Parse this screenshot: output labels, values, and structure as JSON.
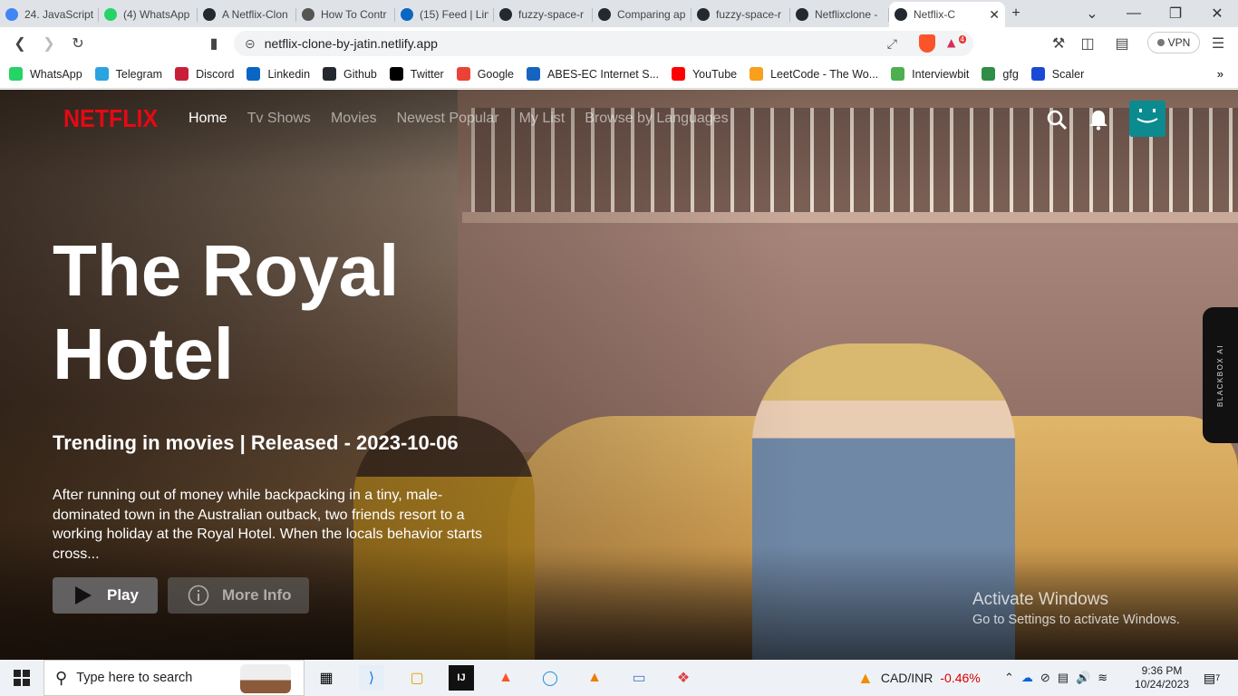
{
  "tabs": [
    {
      "label": "24. JavaScript",
      "color": "#4285f4"
    },
    {
      "label": "(4) WhatsApp",
      "color": "#25d366"
    },
    {
      "label": "A Netflix-Clon",
      "color": "#24292f"
    },
    {
      "label": "How To Contr",
      "color": "#555555"
    },
    {
      "label": "(15) Feed | Lin",
      "color": "#0a66c2"
    },
    {
      "label": "fuzzy-space-r",
      "color": "#24292f"
    },
    {
      "label": "Comparing ap",
      "color": "#24292f"
    },
    {
      "label": "fuzzy-space-r",
      "color": "#24292f"
    },
    {
      "label": "Netflixclone -",
      "color": "#24292f"
    },
    {
      "label": "Netflix-C",
      "color": "#24292f"
    }
  ],
  "address": {
    "url": "netflix-clone-by-jatin.netlify.app",
    "brave_badge": "4",
    "vpn": "VPN"
  },
  "bookmarks": [
    {
      "label": "WhatsApp",
      "color": "#25d366"
    },
    {
      "label": "Telegram",
      "color": "#2aa3df"
    },
    {
      "label": "Discord",
      "color": "#c71f3a"
    },
    {
      "label": "Linkedin",
      "color": "#0a66c2"
    },
    {
      "label": "Github",
      "color": "#24292f"
    },
    {
      "label": "Twitter",
      "color": "#000000"
    },
    {
      "label": "Google",
      "color": "#ea4335"
    },
    {
      "label": "ABES-EC Internet S...",
      "color": "#1565c0"
    },
    {
      "label": "YouTube",
      "color": "#ff0000"
    },
    {
      "label": "LeetCode - The Wo...",
      "color": "#f89f1b"
    },
    {
      "label": "Interviewbit",
      "color": "#4caf50"
    },
    {
      "label": "gfg",
      "color": "#2f8d46"
    },
    {
      "label": "Scaler",
      "color": "#1a49d6"
    }
  ],
  "netflix": {
    "logo": "NETFLIX",
    "nav": [
      "Home",
      "Tv Shows",
      "Movies",
      "Newest Popular",
      "My List",
      "Browse by Languages"
    ],
    "title": "The Royal Hotel",
    "trending": "Trending in movies | Released - 2023-10-06",
    "description": "After running out of money while backpacking in a tiny, male-dominated town in the Australian outback, two friends resort to a working holiday at the Royal Hotel. When the locals behavior starts cross...",
    "play_label": "Play",
    "more_label": "More Info"
  },
  "overlay": {
    "blackbox": "BLACKBOX AI",
    "activate_title": "Activate Windows",
    "activate_sub": "Go to Settings to activate Windows."
  },
  "taskbar": {
    "search_placeholder": "Type here to search",
    "currency": "CAD/INR",
    "change": "-0.46%",
    "time": "9:36 PM",
    "date": "10/24/2023",
    "notif": "7"
  }
}
